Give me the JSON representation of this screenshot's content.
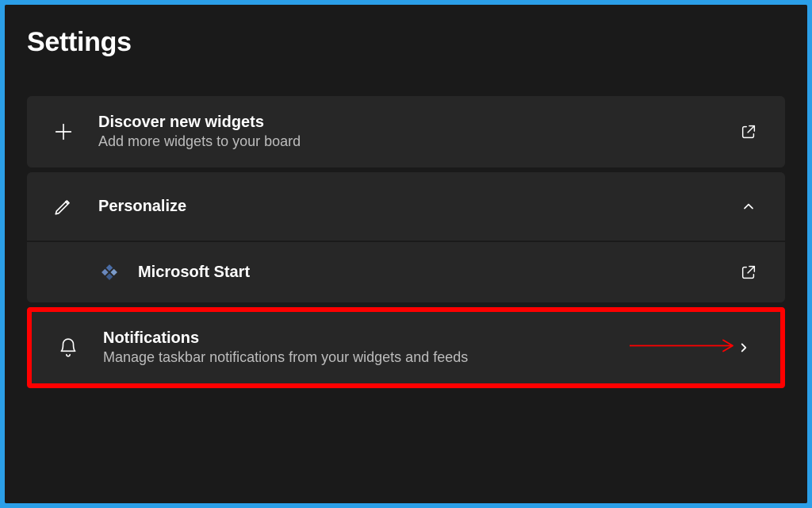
{
  "title": "Settings",
  "items": {
    "discover": {
      "title": "Discover new widgets",
      "subtitle": "Add more widgets to your board"
    },
    "personalize": {
      "title": "Personalize",
      "subitems": {
        "msstart": {
          "label": "Microsoft Start"
        }
      }
    },
    "notifications": {
      "title": "Notifications",
      "subtitle": "Manage taskbar notifications from your widgets and feeds"
    }
  }
}
